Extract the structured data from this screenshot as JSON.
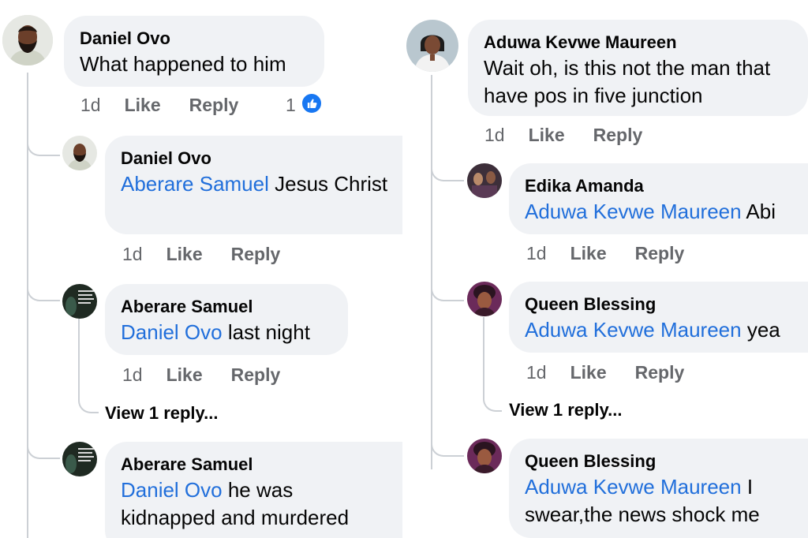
{
  "left_column": {
    "top_comment": {
      "author": "Daniel Ovo",
      "text": "What happened to him",
      "time": "1d",
      "like_label": "Like",
      "reply_label": "Reply",
      "reaction_count": "1"
    },
    "replies": [
      {
        "author": "Daniel Ovo",
        "mention": "Aberare Samuel",
        "text": " Jesus Christ",
        "time": "1d",
        "like_label": "Like",
        "reply_label": "Reply"
      },
      {
        "author": "Aberare Samuel",
        "mention": "Daniel Ovo",
        "text": " last night",
        "time": "1d",
        "like_label": "Like",
        "reply_label": "Reply",
        "view_replies": "View 1 reply..."
      },
      {
        "author": "Aberare Samuel",
        "mention": "Daniel Ovo",
        "text": " he was kidnapped and murdered"
      }
    ]
  },
  "right_column": {
    "top_comment": {
      "author": "Aduwa Kevwe Maureen",
      "text": "Wait oh, is this not the man that have pos in five junction",
      "time": "1d",
      "like_label": "Like",
      "reply_label": "Reply"
    },
    "replies": [
      {
        "author": "Edika Amanda",
        "mention": "Aduwa Kevwe Maureen",
        "text": " Abi",
        "time": "1d",
        "like_label": "Like",
        "reply_label": "Reply"
      },
      {
        "author": "Queen Blessing",
        "mention": "Aduwa Kevwe Maureen",
        "text": " yea",
        "time": "1d",
        "like_label": "Like",
        "reply_label": "Reply",
        "view_replies": "View 1 reply..."
      },
      {
        "author": "Queen Blessing",
        "mention": "Aduwa Kevwe Maureen",
        "text": " I swear,the news shock me"
      }
    ]
  },
  "colors": {
    "bubble": "#f0f2f5",
    "mention": "#216fdb",
    "meta": "#65676b",
    "thread_line": "#ccd0d5",
    "like_icon": "#1877f2"
  },
  "icons": {
    "reaction": "thumbs-up-icon"
  }
}
